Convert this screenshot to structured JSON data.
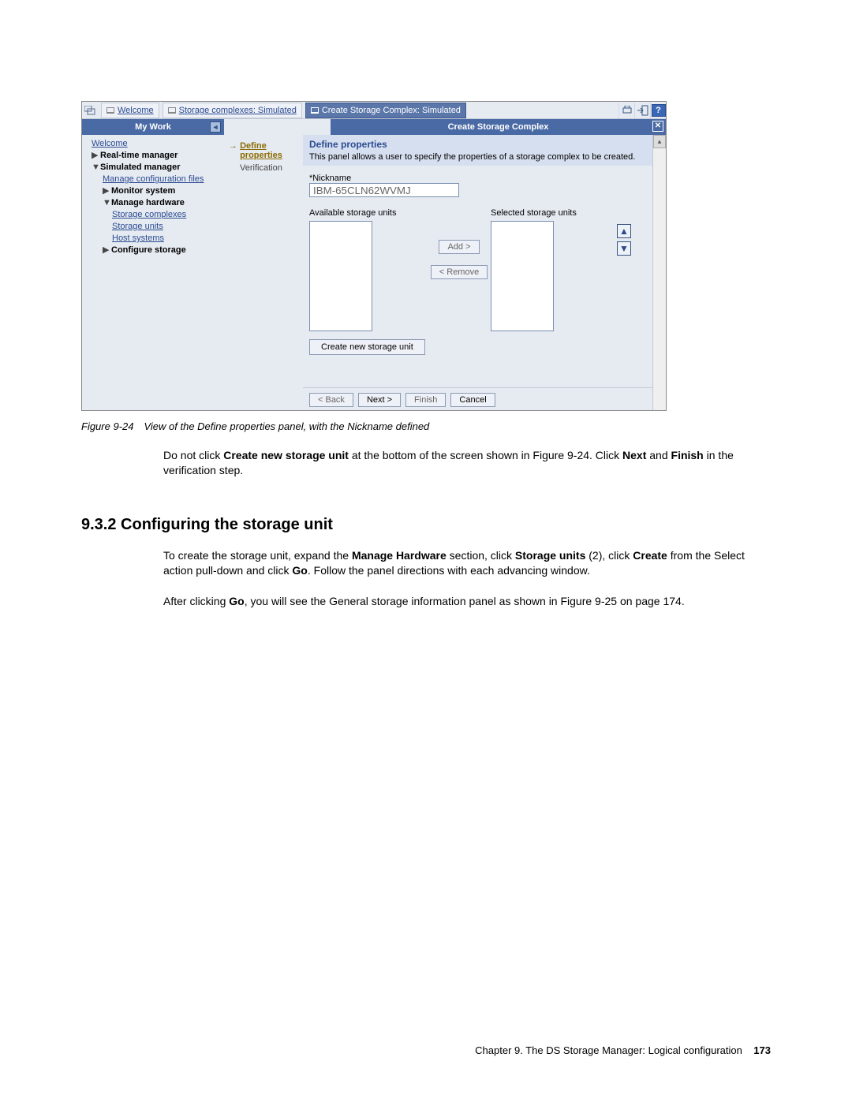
{
  "toolbar": {
    "tab_welcome": "Welcome",
    "tab_complexes": "Storage complexes: Simulated",
    "tab_create": "Create Storage Complex: Simulated",
    "help": "?"
  },
  "subheader": {
    "my_work": "My Work",
    "create_complex": "Create Storage Complex"
  },
  "sidebar": {
    "welcome": "Welcome",
    "rt_manager": "Real-time manager",
    "sim_manager": "Simulated manager",
    "manage_config": "Manage configuration files",
    "monitor": "Monitor system",
    "manage_hw": "Manage hardware",
    "storage_complexes": "Storage complexes",
    "storage_units": "Storage units",
    "host_systems": "Host systems",
    "configure_storage": "Configure storage"
  },
  "wizard": {
    "step1_a": "Define",
    "step1_b": "properties",
    "step2": "Verification"
  },
  "main": {
    "title": "Define properties",
    "desc": "This panel allows a user to specify the properties of a storage complex to be created.",
    "nickname_label": "*Nickname",
    "nickname_value": "IBM-65CLN62WVMJ",
    "available_label": "Available storage units",
    "selected_label": "Selected storage units",
    "add_btn": "Add >",
    "remove_btn": "< Remove",
    "create_new_btn": "Create new storage unit"
  },
  "footer": {
    "back": "< Back",
    "next": "Next >",
    "finish": "Finish",
    "cancel": "Cancel"
  },
  "doc": {
    "caption": "Figure 9-24 View of the Define properties panel, with the Nickname defined",
    "para1_a": "Do not click ",
    "para1_b": "Create new storage unit",
    "para1_c": " at the bottom of the screen shown in Figure 9-24. Click ",
    "para1_d": "Next",
    "para1_e": " and ",
    "para1_f": "Finish",
    "para1_g": " in the verification step.",
    "heading": "9.3.2  Configuring the storage unit",
    "para2_a": "To create the storage unit, expand the ",
    "para2_b": "Manage Hardware",
    "para2_c": " section, click ",
    "para2_d": "Storage units",
    "para2_e": " (2), click ",
    "para2_f": "Create",
    "para2_g": " from the Select action pull-down and click ",
    "para2_h": "Go",
    "para2_i": ". Follow the panel directions with each advancing window.",
    "para3_a": "After clicking ",
    "para3_b": "Go",
    "para3_c": ", you will see the General storage information panel as shown in Figure 9-25 on page 174.",
    "footer_chapter": "Chapter 9. The DS Storage Manager: Logical configuration",
    "footer_page": "173"
  }
}
